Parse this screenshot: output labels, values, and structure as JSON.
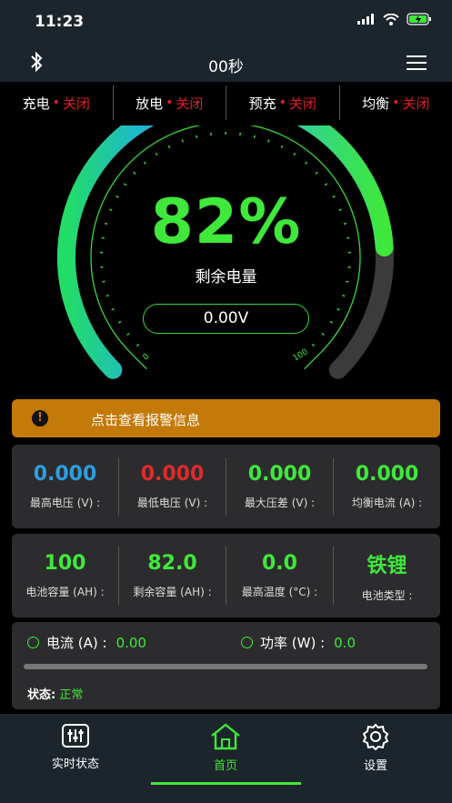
{
  "status_bar": {
    "time": "11:23"
  },
  "nav": {
    "title": "00秒"
  },
  "switches": [
    {
      "name": "充电",
      "state": "关闭"
    },
    {
      "name": "放电",
      "state": "关闭"
    },
    {
      "name": "预充",
      "state": "关闭"
    },
    {
      "name": "均衡",
      "state": "关闭"
    }
  ],
  "gauge": {
    "percent_text": "82%",
    "percent_value": 82,
    "label": "剩余电量",
    "voltage": "0.00V",
    "tick_min": "0",
    "tick_max": "100"
  },
  "alarm": {
    "text": "点击查看报警信息"
  },
  "stats1": [
    {
      "value": "0.000",
      "label": "最高电压 (V) :",
      "color": "#2b9fe0"
    },
    {
      "value": "0.000",
      "label": "最低电压 (V) :",
      "color": "#e02a2a"
    },
    {
      "value": "0.000",
      "label": "最大压差 (V) :",
      "color": "#3fe83a"
    },
    {
      "value": "0.000",
      "label": "均衡电流 (A) :",
      "color": "#3fe83a"
    }
  ],
  "stats2": [
    {
      "value": "100",
      "label": "电池容量 (AH) :"
    },
    {
      "value": "82.0",
      "label": "剩余容量 (AH) :"
    },
    {
      "value": "0.0",
      "label": "最高温度 (°C) :"
    },
    {
      "value": "铁锂",
      "label": "电池类型 :"
    }
  ],
  "power": {
    "current_label": "电流 (A) :",
    "current_value": "0.00",
    "power_label": "功率 (W) :",
    "power_value": "0.0",
    "state_label": "状态:",
    "state_value": "正常"
  },
  "tabs": [
    {
      "label": "实时状态"
    },
    {
      "label": "首页"
    },
    {
      "label": "设置"
    }
  ],
  "colors": {
    "accent": "#3fe83a",
    "warning": "#c47a08",
    "danger": "#e02020"
  }
}
